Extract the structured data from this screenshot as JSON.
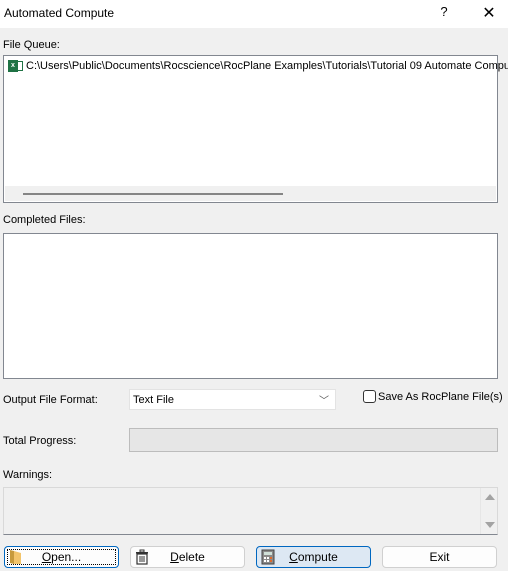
{
  "window": {
    "title": "Automated Compute",
    "help_icon": "?",
    "close_icon": "✕"
  },
  "file_queue": {
    "label": "File Queue:",
    "items": [
      {
        "icon": "excel-file-icon",
        "path": "C:\\Users\\Public\\Documents\\Rocscience\\RocPlane Examples\\Tutorials\\Tutorial 09 Automate Compu"
      }
    ]
  },
  "completed_files": {
    "label": "Completed Files:",
    "items": []
  },
  "output": {
    "label": "Output File Format:",
    "selected": "Text File",
    "save_as_label": "Save As RocPlane File(s)",
    "save_as_checked": false
  },
  "progress": {
    "label": "Total Progress:",
    "value_percent": 0
  },
  "warnings": {
    "label": "Warnings:",
    "text": ""
  },
  "buttons": {
    "open": {
      "mnemonic": "O",
      "rest": "pen...",
      "icon": "folder-icon"
    },
    "delete": {
      "mnemonic": "D",
      "rest": "elete",
      "icon": "trash-icon"
    },
    "compute": {
      "mnemonic": "C",
      "rest": "ompute",
      "icon": "calculator-icon"
    },
    "exit": {
      "label": "Exit"
    }
  }
}
